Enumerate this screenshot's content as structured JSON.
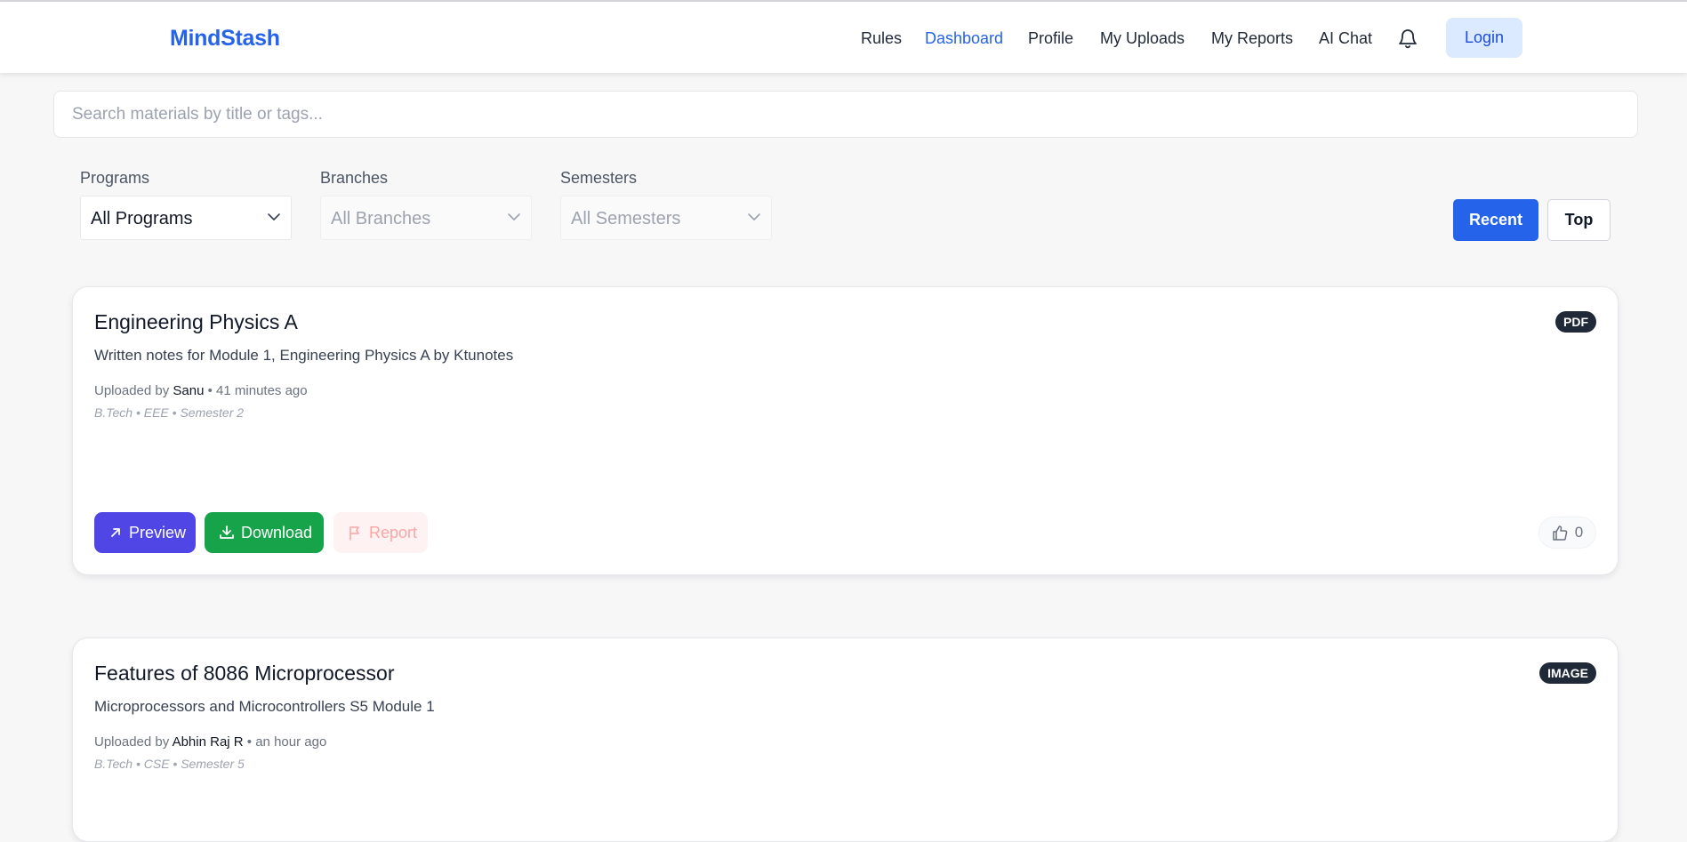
{
  "app": {
    "brand": "MindStash"
  },
  "nav": {
    "items": [
      {
        "label": "Rules",
        "active": false
      },
      {
        "label": "Dashboard",
        "active": true
      },
      {
        "label": "Profile",
        "active": false
      },
      {
        "label": "My Uploads",
        "active": false
      },
      {
        "label": "My Reports",
        "active": false
      },
      {
        "label": "AI Chat",
        "active": false
      }
    ],
    "bell_icon": "bell-icon",
    "login_label": "Login"
  },
  "search": {
    "placeholder": "Search materials by title or tags...",
    "value": ""
  },
  "filters": {
    "programs": {
      "label": "Programs",
      "value": "All Programs",
      "enabled": true
    },
    "branches": {
      "label": "Branches",
      "value": "All Branches",
      "enabled": false
    },
    "semesters": {
      "label": "Semesters",
      "value": "All Semesters",
      "enabled": false
    }
  },
  "sort": {
    "recent_label": "Recent",
    "top_label": "Top",
    "selected": "Recent"
  },
  "materials": [
    {
      "title": "Engineering Physics A",
      "description": "Written notes for Module 1, Engineering Physics A by Ktunotes",
      "uploaded_prefix": "Uploaded by",
      "uploader": "Sanu",
      "time": "• 41 minutes ago",
      "tags": "B.Tech • EEE • Semester 2",
      "badge": "PDF",
      "preview_label": "Preview",
      "download_label": "Download",
      "report_label": "Report",
      "likes": "0"
    },
    {
      "title": "Features of 8086 Microprocessor",
      "description": "Microprocessors and Microcontrollers S5 Module 1",
      "uploaded_prefix": "Uploaded by",
      "uploader": "Abhin Raj R",
      "time": "• an hour ago",
      "tags": "B.Tech • CSE • Semester 5",
      "badge": "IMAGE"
    }
  ],
  "colors": {
    "brand": "#2563eb",
    "preview": "#4f46e5",
    "download": "#16a34a",
    "report_bg": "#fef2f2",
    "badge": "#1f2937"
  }
}
